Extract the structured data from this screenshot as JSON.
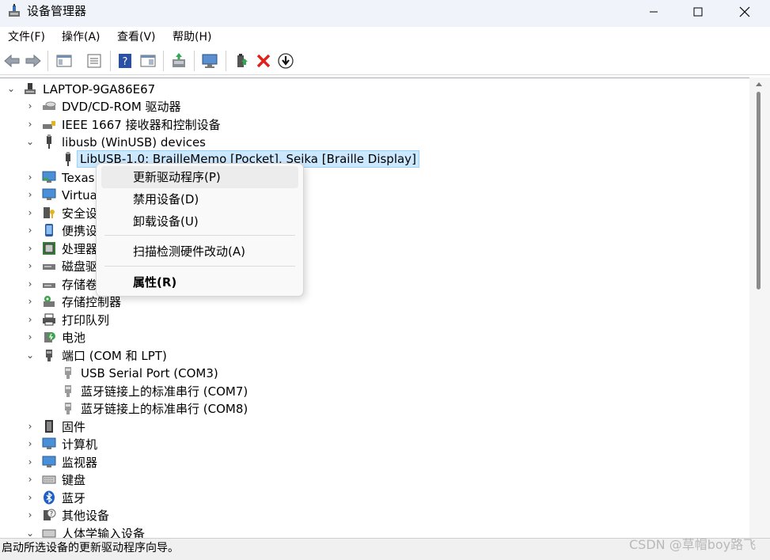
{
  "window": {
    "title": "设备管理器"
  },
  "menu": [
    "文件(F)",
    "操作(A)",
    "查看(V)",
    "帮助(H)"
  ],
  "toolbar": [
    "back-icon",
    "forward-icon",
    "show-hide-console-tree-icon",
    "properties-icon",
    "help-icon",
    "action-pane-icon",
    "update-driver-icon",
    "scan-hardware-icon",
    "add-legacy-icon",
    "uninstall-icon",
    "enable-device-icon"
  ],
  "tree": {
    "root": "LAPTOP-9GA86E67",
    "items": [
      "DVD/CD-ROM 驱动器",
      "IEEE 1667 接收器和控制设备",
      "libusb (WinUSB) devices",
      "LibUSB-1.0: BrailleMemo [Pocket], Seika [Braille Display]",
      "Texas",
      "Virtual",
      "安全设",
      "便携设",
      "处理器",
      "磁盘驱",
      "存储卷",
      "存储控制器",
      "打印队列",
      "电池",
      "端口 (COM 和 LPT)",
      "USB Serial Port (COM3)",
      "蓝牙链接上的标准串行 (COM7)",
      "蓝牙链接上的标准串行 (COM8)",
      "固件",
      "计算机",
      "监视器",
      "键盘",
      "蓝牙",
      "其他设备",
      "人体学输入设备"
    ]
  },
  "context_menu": {
    "update_driver": "更新驱动程序(P)",
    "disable": "禁用设备(D)",
    "uninstall": "卸载设备(U)",
    "scan": "扫描检测硬件改动(A)",
    "properties": "属性(R)"
  },
  "status": "启动所选设备的更新驱动程序向导。",
  "watermark": "CSDN @草帽boy路飞"
}
